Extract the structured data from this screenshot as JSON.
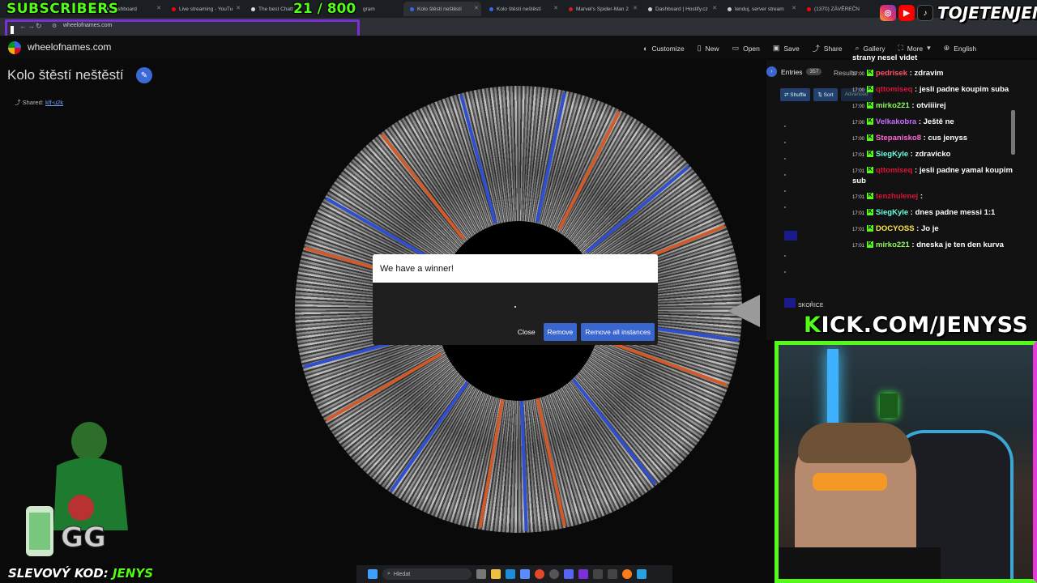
{
  "tabs": [
    {
      "label": "Kick Dashboard",
      "icon": "kick-icon",
      "color": "#53fc18"
    },
    {
      "label": "Live streaming - YouTu",
      "icon": "youtube-icon",
      "color": "#ff0000"
    },
    {
      "label": "The best Chatt",
      "icon": "chat-icon",
      "color": "#dddddd"
    },
    {
      "label": "gram",
      "icon": "instagram-icon",
      "color": "#e1306c"
    },
    {
      "label": "Kolo štěstí neštěstí",
      "icon": "wheel-icon",
      "color": "#3369e8",
      "active": true
    },
    {
      "label": "Kolo štěstí neštěstí",
      "icon": "wheel-icon",
      "color": "#3369e8"
    },
    {
      "label": "Marvel's Spider-Man 2",
      "icon": "spider-icon",
      "color": "#d21c1c"
    },
    {
      "label": "Dashboard | Hostify.cz",
      "icon": "doc-icon",
      "color": "#cccccc"
    },
    {
      "label": "lenduj, server stream",
      "icon": "doc-icon",
      "color": "#cccccc"
    },
    {
      "label": "(1370) ZÁVĚREČN",
      "icon": "youtube-icon",
      "color": "#ff0000"
    }
  ],
  "address": {
    "url": "wheelofnames.com"
  },
  "overlay": {
    "subs_label": "SUBSCRIBERS",
    "sub_count": "21 / 800",
    "social_handle": "TOJETENJENYS",
    "kick_url_prefix": "K",
    "kick_url_rest": "ICK.COM/JENYSS",
    "promo_label": "SLEVOVÝ KOD:",
    "promo_code": "JENYS"
  },
  "site": {
    "name": "wheelofnames.com",
    "menu": [
      {
        "label": "Customize",
        "icon": "palette-icon"
      },
      {
        "label": "New",
        "icon": "file-icon"
      },
      {
        "label": "Open",
        "icon": "folder-icon"
      },
      {
        "label": "Save",
        "icon": "save-icon"
      },
      {
        "label": "Share",
        "icon": "share-icon"
      },
      {
        "label": "Gallery",
        "icon": "search-icon"
      },
      {
        "label": "More",
        "icon": "fullscreen-icon"
      },
      {
        "label": "English",
        "icon": "globe-icon"
      }
    ]
  },
  "wheel": {
    "title": "Kolo štěstí neštěstí",
    "shared_label": "Shared:",
    "shared_link": "klf-u2k"
  },
  "dialog": {
    "title": "We have a winner!",
    "close": "Close",
    "remove": "Remove",
    "remove_all": "Remove all instances"
  },
  "entries": {
    "label": "Entries",
    "count": "357",
    "results_label": "Results",
    "shuffle": "Shuffle",
    "sort": "Sort",
    "advanced": "Advanced"
  },
  "chat": [
    {
      "time": "",
      "user": "",
      "user_color": "#ffffff",
      "text": "strany nesel videt"
    },
    {
      "time": "17:00",
      "user": "pedrisek",
      "user_color": "#ff4f6d",
      "text": ": zdravim"
    },
    {
      "time": "17:00",
      "user": "qttomiseq",
      "user_color": "#d8143a",
      "text": ": jesli padne koupim suba"
    },
    {
      "time": "17:00",
      "user": "mirko221",
      "user_color": "#8ff95c",
      "text": ": otviiiirej"
    },
    {
      "time": "17:00",
      "user": "Velkakobra",
      "user_color": "#c56cff",
      "text": ": Ještě ne"
    },
    {
      "time": "17:00",
      "user": "Stepanisko8",
      "user_color": "#ff6ad5",
      "text": ": cus jenyss"
    },
    {
      "time": "17:01",
      "user": "SiegKyle",
      "user_color": "#66ffe0",
      "text": ": zdravicko"
    },
    {
      "time": "17:01",
      "user": "qttomiseq",
      "user_color": "#d8143a",
      "text": ": jesli padne yamal koupim sub"
    },
    {
      "time": "17:01",
      "user": "tenzhulenej",
      "user_color": "#d8143a",
      "text": ":"
    },
    {
      "time": "17:01",
      "user": "SiegKyle",
      "user_color": "#66ffe0",
      "text": ": dnes padne messi 1:1"
    },
    {
      "time": "17:01",
      "user": "DOCYOSS",
      "user_color": "#ffe94a",
      "text": ": Jo je"
    },
    {
      "time": "17:01",
      "user": "mirko221",
      "user_color": "#8ff95c",
      "text": ": dneska je ten den kurva"
    }
  ],
  "sidebar_entry_visible": "SKOŘICE",
  "taskbar": {
    "search_placeholder": "Hledat"
  },
  "colors": {
    "kick_green": "#53fc18",
    "accent_blue": "#3a66d0",
    "stream_pink": "#e23bd8"
  }
}
